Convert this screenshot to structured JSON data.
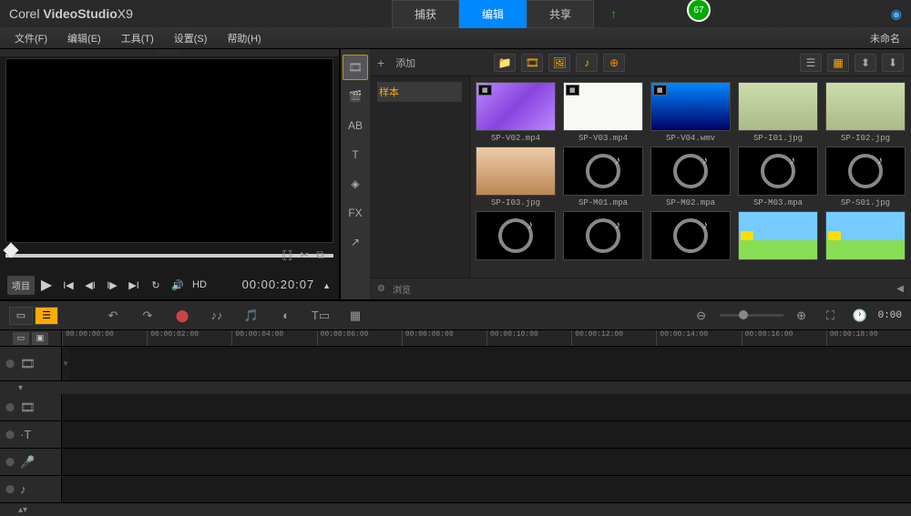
{
  "app": {
    "brand": "Corel",
    "product": "VideoStudio",
    "version": "X9"
  },
  "mainTabs": {
    "capture": "捕获",
    "edit": "编辑",
    "share": "共享"
  },
  "badge": "67",
  "menu": {
    "file": "文件(F)",
    "edit": "编辑(E)",
    "tools": "工具(T)",
    "settings": "设置(S)",
    "help": "帮助(H)"
  },
  "projectName": "未命名",
  "preview": {
    "mode": "项目",
    "hd": "HD",
    "timecode": "00:00:20:07",
    "frame": "1"
  },
  "library": {
    "add": "添加",
    "treeItem": "样本",
    "browse": "浏览",
    "thumbs": [
      {
        "name": "SP-V02.mp4",
        "cls": "purple",
        "badge": "▦"
      },
      {
        "name": "SP-V03.mp4",
        "cls": "white",
        "badge": "▦"
      },
      {
        "name": "SP-V04.wmv",
        "cls": "blue",
        "badge": "▦"
      },
      {
        "name": "SP-I01.jpg",
        "cls": "flower",
        "badge": ""
      },
      {
        "name": "SP-I02.jpg",
        "cls": "flower",
        "badge": ""
      },
      {
        "name": "SP-I03.jpg",
        "cls": "desert",
        "badge": ""
      },
      {
        "name": "SP-M01.mpa",
        "cls": "audio",
        "badge": ""
      },
      {
        "name": "SP-M02.mpa",
        "cls": "audio",
        "badge": ""
      },
      {
        "name": "SP-M03.mpa",
        "cls": "audio",
        "badge": ""
      },
      {
        "name": "SP-S01.jpg",
        "cls": "audio",
        "badge": ""
      }
    ]
  },
  "timeline": {
    "ticks": [
      "00:00:00:00",
      "00:00:02:00",
      "00:00:04:00",
      "00:00:06:00",
      "00:00:08:00",
      "00:00:10:00",
      "00:00:12:00",
      "00:00:14:00",
      "00:00:16:00",
      "00:00:18:00"
    ],
    "endTime": "0:00"
  }
}
